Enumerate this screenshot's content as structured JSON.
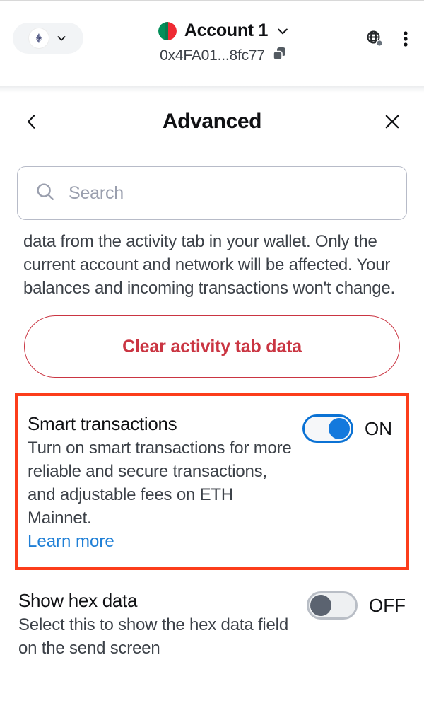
{
  "wallet_header": {
    "network_selector": {
      "name": "Ethereum Mainnet",
      "icon": "ethereum-icon",
      "chevron_icon": "chevron-down-icon"
    },
    "account": {
      "name": "Account 1",
      "address": "0x4FA01...8fc77",
      "avatar_icon": "account-identicon",
      "chevron_icon": "chevron-down-icon",
      "copy_icon": "copy-icon"
    },
    "actions": {
      "connection_status_icon": "globe-connection-icon",
      "more_options_icon": "three-dots-vertical-icon"
    }
  },
  "page": {
    "title": "Advanced",
    "back_icon": "chevron-left-icon",
    "close_icon": "close-icon"
  },
  "search": {
    "placeholder": "Search",
    "value": "",
    "icon": "search-icon"
  },
  "clear_activity": {
    "description": "data from the activity tab in your wallet. Only the current account and network will be affected. Your balances and incoming transactions won't change.",
    "button_label": "Clear activity tab data"
  },
  "settings": [
    {
      "title": "Smart transactions",
      "description": "Turn on smart transactions for more reliable and secure transactions, and adjustable fees on ETH Mainnet.",
      "link_label": "Learn more",
      "toggle_state": "ON",
      "highlighted": true
    },
    {
      "title": "Show hex data",
      "description": "Select this to show the hex data field on the send screen",
      "toggle_state": "OFF",
      "highlighted": false
    }
  ],
  "colors": {
    "accent_blue": "#1479dd",
    "link_blue": "#1f7fd6",
    "danger_red": "#ca3542",
    "highlight_red": "#fc3d1b",
    "text_primary": "#101114",
    "text_secondary": "#3c4148"
  }
}
